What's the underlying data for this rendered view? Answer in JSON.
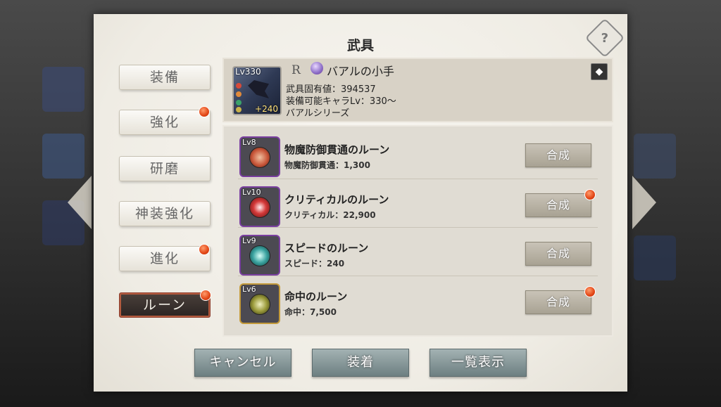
{
  "panel": {
    "title": "武具"
  },
  "tabs": [
    {
      "label": "装備",
      "badge": false
    },
    {
      "label": "強化",
      "badge": true
    },
    {
      "label": "研磨",
      "badge": false
    },
    {
      "label": "神装強化",
      "badge": false
    },
    {
      "label": "進化",
      "badge": true
    },
    {
      "label": "ルーン",
      "badge": true,
      "active": true
    }
  ],
  "weapon": {
    "level": "Lv330",
    "plus": "+240",
    "rarity": "R",
    "name": "バアルの小手",
    "unique_value": "武具固有値：394537",
    "equip_level": "装備可能キャラLv：330～",
    "series": "バアルシリーズ"
  },
  "runes": [
    {
      "level": "Lv8",
      "name": "物魔防御貫通のルーン",
      "stat": "物魔防御貫通：1,300",
      "button": "合成",
      "badge": false,
      "orb_color": "#c9573a"
    },
    {
      "level": "Lv10",
      "name": "クリティカルのルーン",
      "stat": "クリティカル：22,900",
      "button": "合成",
      "badge": true,
      "orb_color": "#d63a3a"
    },
    {
      "level": "Lv9",
      "name": "スピードのルーン",
      "stat": "スピード：240",
      "button": "合成",
      "badge": false,
      "orb_color": "#3aa3a0"
    },
    {
      "level": "Lv6",
      "name": "命中のルーン",
      "stat": "命中：7,500",
      "button": "合成",
      "badge": true,
      "orb_color": "#9a9a3a"
    }
  ],
  "buttons": {
    "cancel": "キャンセル",
    "equip": "装着",
    "list_view": "一覧表示"
  },
  "help": {
    "icon": "?"
  }
}
